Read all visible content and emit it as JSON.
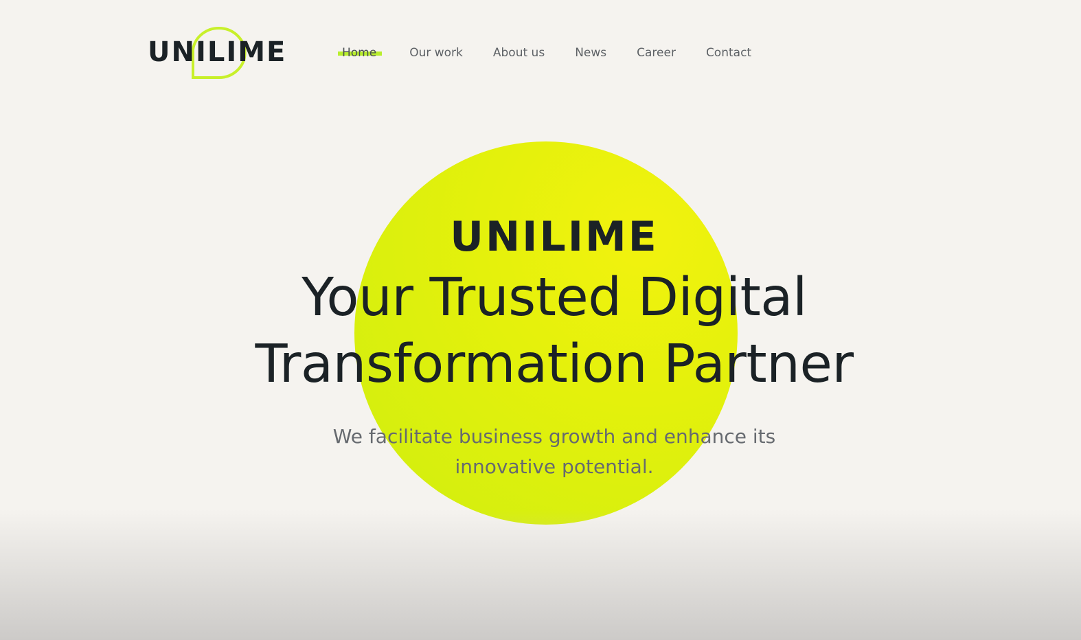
{
  "brand": {
    "logo_text": "UNILIME",
    "accent_color": "#c8f02a",
    "text_color": "#1b2226"
  },
  "nav": {
    "items": [
      {
        "label": "Home",
        "active": true
      },
      {
        "label": "Our work",
        "active": false
      },
      {
        "label": "About us",
        "active": false
      },
      {
        "label": "News",
        "active": false
      },
      {
        "label": "Career",
        "active": false
      },
      {
        "label": "Contact",
        "active": false
      }
    ]
  },
  "hero": {
    "brand": "UNILIME",
    "title_line1": "Your Trusted Digital",
    "title_line2": "Transformation Partner",
    "subtitle_line1": "We facilitate business growth and enhance its",
    "subtitle_line2": "innovative potential.",
    "sun_color": "#e4f10c"
  }
}
